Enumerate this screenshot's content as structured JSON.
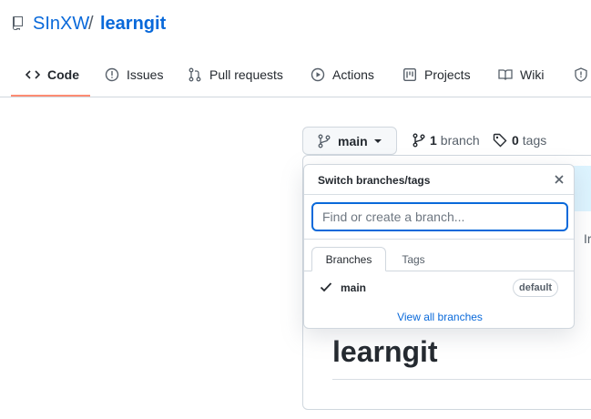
{
  "repo": {
    "owner": "SInXW",
    "separator": "/",
    "name": "learngit"
  },
  "nav": {
    "tabs": [
      {
        "label": "Code",
        "icon": "code-icon",
        "active": true
      },
      {
        "label": "Issues",
        "icon": "issue-icon"
      },
      {
        "label": "Pull requests",
        "icon": "pull-request-icon"
      },
      {
        "label": "Actions",
        "icon": "play-icon"
      },
      {
        "label": "Projects",
        "icon": "project-icon"
      },
      {
        "label": "Wiki",
        "icon": "book-icon"
      }
    ]
  },
  "branch": {
    "current": "main",
    "branch_count": "1",
    "branch_word": "branch",
    "tag_count": "0",
    "tag_word": "tags"
  },
  "dropdown": {
    "title": "Switch branches/tags",
    "search_placeholder": "Find or create a branch...",
    "tab_branches": "Branches",
    "tab_tags": "Tags",
    "items": [
      {
        "name": "main",
        "badge": "default",
        "selected": true
      }
    ],
    "view_all": "View all branches"
  },
  "background": {
    "partial_text": "Ir"
  },
  "readme": {
    "title": "learngit"
  },
  "colors": {
    "link": "#0969da",
    "active_underline": "#fd8c73",
    "focus_border": "#0969da"
  }
}
